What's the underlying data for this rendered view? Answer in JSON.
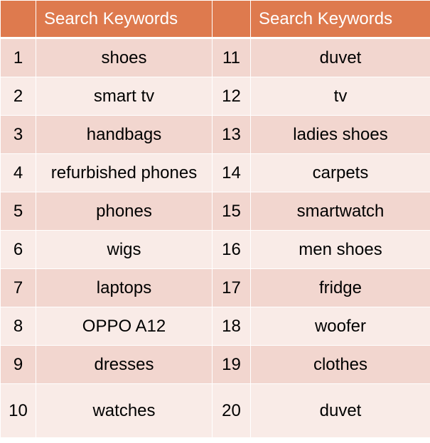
{
  "header": {
    "num1": "",
    "kw1": "Search Keywords",
    "num2": "",
    "kw2": "Search Keywords"
  },
  "colors": {
    "header": "#DE7A4E",
    "row_dark": "#F2D6CF",
    "row_light": "#F9EBE7"
  },
  "rows": [
    {
      "n1": "1",
      "k1": "shoes",
      "n2": "11",
      "k2": "duvet"
    },
    {
      "n1": "2",
      "k1": "smart tv",
      "n2": "12",
      "k2": "tv"
    },
    {
      "n1": "3",
      "k1": "handbags",
      "n2": "13",
      "k2": "ladies shoes"
    },
    {
      "n1": "4",
      "k1": "refurbished phones",
      "n2": "14",
      "k2": "carpets"
    },
    {
      "n1": "5",
      "k1": "phones",
      "n2": "15",
      "k2": "smartwatch"
    },
    {
      "n1": "6",
      "k1": "wigs",
      "n2": "16",
      "k2": "men shoes"
    },
    {
      "n1": "7",
      "k1": "laptops",
      "n2": "17",
      "k2": "fridge"
    },
    {
      "n1": "8",
      "k1": "OPPO A12",
      "n2": "18",
      "k2": "woofer"
    },
    {
      "n1": "9",
      "k1": "dresses",
      "n2": "19",
      "k2": "clothes"
    },
    {
      "n1": "10",
      "k1": "watches",
      "n2": "20",
      "k2": "duvet"
    }
  ]
}
